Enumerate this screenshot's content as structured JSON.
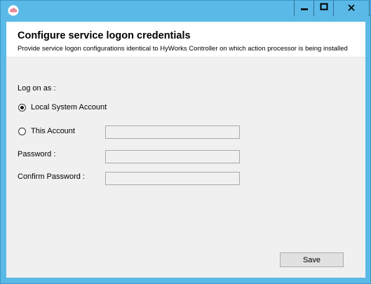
{
  "window": {
    "app_icon": "cloud-icon",
    "controls": {
      "minimize_icon": "minimize-icon",
      "maximize_icon": "maximize-icon",
      "close_icon": "close-icon"
    }
  },
  "header": {
    "title": "Configure service logon credentials",
    "subtitle": "Provide service logon configurations identical to HyWorks Controller on which action processor is being installed"
  },
  "form": {
    "log_on_as_label": "Log on as :",
    "options": [
      {
        "label": "Local System Account",
        "selected": true
      },
      {
        "label": "This Account",
        "selected": false
      }
    ],
    "account_value": "",
    "password_label": "Password :",
    "password_value": "",
    "confirm_password_label": "Confirm Password :",
    "confirm_password_value": ""
  },
  "footer": {
    "save_label": "Save"
  },
  "colors": {
    "frame": "#5ab9e7",
    "client": "#f0f0f0",
    "header": "#ffffff"
  }
}
